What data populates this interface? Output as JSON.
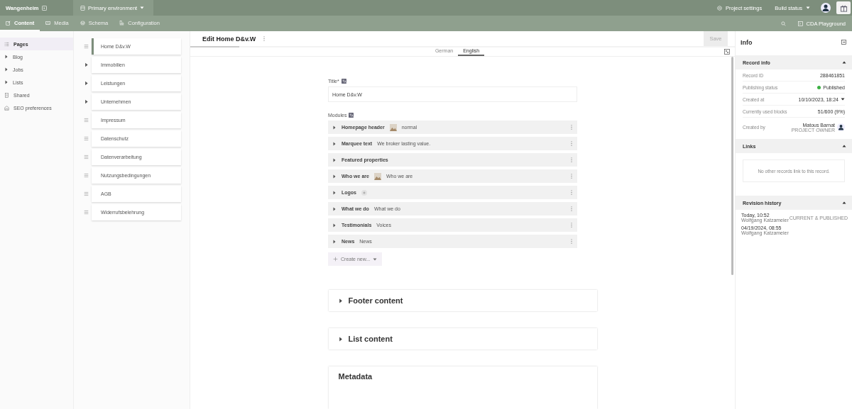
{
  "topbar": {
    "project": "Wangenheim",
    "environment": "Primary environment",
    "project_settings": "Project settings",
    "build_status": "Build status"
  },
  "tabs": [
    {
      "label": "Content",
      "selected": true
    },
    {
      "label": "Media",
      "selected": false
    },
    {
      "label": "Schema",
      "selected": false
    },
    {
      "label": "Configuration",
      "selected": false
    }
  ],
  "cda_playground": "CDA Playground",
  "sidebar": {
    "items": [
      {
        "label": "Pages",
        "kind": "list",
        "selected": true
      },
      {
        "label": "Blog",
        "kind": "folder",
        "selected": false
      },
      {
        "label": "Jobs",
        "kind": "folder",
        "selected": false
      },
      {
        "label": "Lists",
        "kind": "folder",
        "selected": false
      },
      {
        "label": "Shared",
        "kind": "page",
        "selected": false
      },
      {
        "label": "SEO preferences",
        "kind": "settings",
        "selected": false
      }
    ]
  },
  "pages": [
    {
      "label": "Home D&v.W",
      "kind": "drag",
      "selected": true
    },
    {
      "label": "Immobilien",
      "kind": "expand",
      "selected": false
    },
    {
      "label": "Leistungen",
      "kind": "expand",
      "selected": false
    },
    {
      "label": "Unternehmen",
      "kind": "expand",
      "selected": false
    },
    {
      "label": "Impressum",
      "kind": "drag",
      "selected": false
    },
    {
      "label": "Datenschutz",
      "kind": "drag",
      "selected": false
    },
    {
      "label": "Datenverarbeitung",
      "kind": "drag",
      "selected": false
    },
    {
      "label": "Nutzungsbedingungen",
      "kind": "drag",
      "selected": false
    },
    {
      "label": "AGB",
      "kind": "drag",
      "selected": false
    },
    {
      "label": "Widerrufsbelehrung",
      "kind": "drag",
      "selected": false
    }
  ],
  "editor": {
    "title": "Edit Home D&v.W",
    "save": "Save",
    "save_disabled": true,
    "progress": {
      "level": 0.09
    },
    "locales": [
      {
        "label": "German",
        "selected": false
      },
      {
        "label": "English",
        "selected": true
      }
    ],
    "title_field": {
      "label": "Title*",
      "value": "Home D&v.W"
    },
    "modules_label": "Modules",
    "modules": [
      {
        "name": "Homepage header",
        "kind": "image",
        "summary": "normal"
      },
      {
        "name": "Marquee text",
        "kind": "text",
        "summary": "We broker lasting value."
      },
      {
        "name": "Featured properties",
        "kind": "text"
      },
      {
        "name": "Who we are",
        "kind": "image",
        "summary": "Who we are"
      },
      {
        "name": "Logos",
        "kind": "empty"
      },
      {
        "name": "What we do",
        "kind": "text",
        "summary": "What we do"
      },
      {
        "name": "Testimonials",
        "kind": "text",
        "summary": "Voices"
      },
      {
        "name": "News",
        "kind": "text",
        "summary": "News"
      }
    ],
    "create_new": "Create new...",
    "sections": [
      {
        "title": "Footer content",
        "kind": "collapsed"
      },
      {
        "title": "List content",
        "kind": "collapsed"
      },
      {
        "title": "Metadata",
        "kind": "open"
      }
    ]
  },
  "info": {
    "title": "Info",
    "record_info": {
      "title": "Record info",
      "record_id_label": "Record ID",
      "record_id": "288461851",
      "status_label": "Publishing status",
      "status": {
        "text": "Published",
        "color": "#3cb043"
      },
      "created_at_label": "Created at",
      "created_at": "10/10/2023, 18:24",
      "blocks_label": "Currently used blocks",
      "blocks": "51/600 (9%)",
      "created_by_label": "Created by",
      "creator_name": "Matous Barnat",
      "creator_role": "PROJECT OWNER"
    },
    "links": {
      "title": "Links",
      "empty": "No other records link to this record."
    },
    "revisions": {
      "title": "Revision history",
      "items": [
        {
          "time": "Today, 10:52",
          "author": "Wolfgang Katzameier",
          "badge": "CURRENT & PUBLISHED"
        },
        {
          "time": "04/19/2024, 08:55",
          "author": "Wolfgang Katzameier"
        }
      ]
    }
  }
}
